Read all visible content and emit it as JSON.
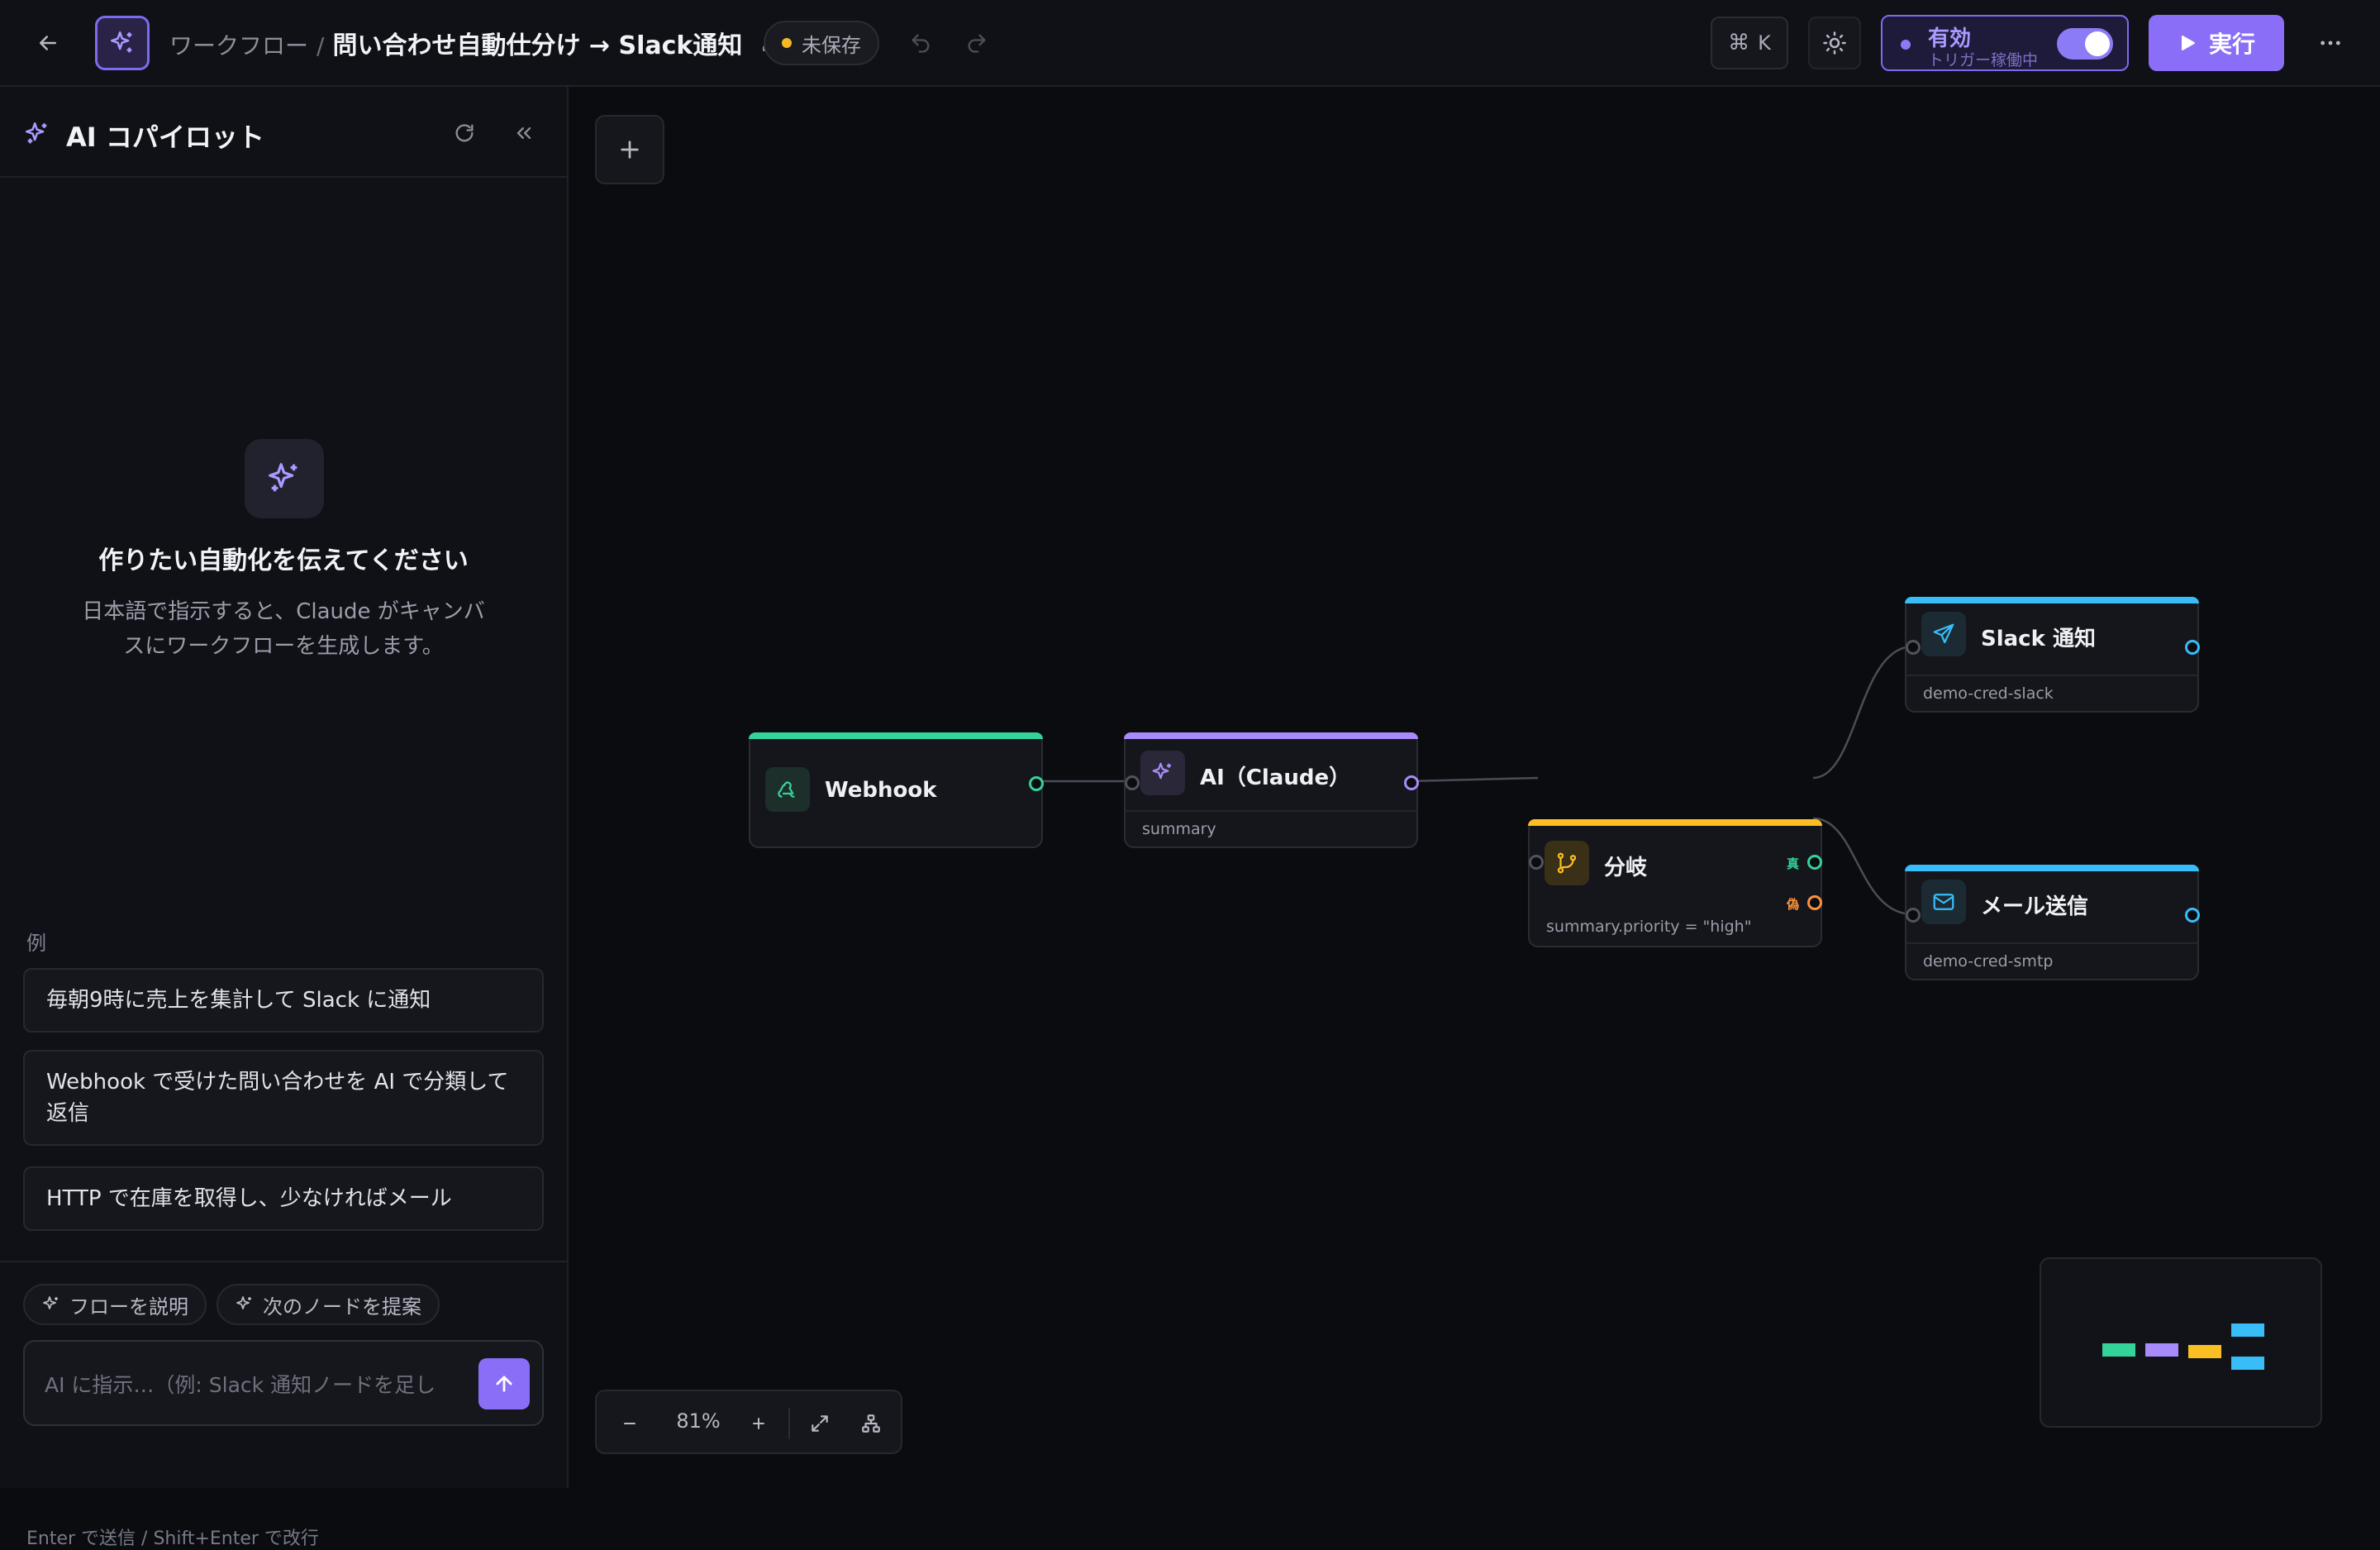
{
  "header": {
    "breadcrumb_parent": "ワークフロー",
    "breadcrumb_sep": "/",
    "title": "問い合わせ自動仕分け → Slack通知",
    "unsaved": "未保存",
    "kbd_shortcut": "K",
    "active_label": "有効",
    "active_sub": "トリガー稼働中",
    "active_on": true,
    "run_label": "実行"
  },
  "sidebar": {
    "title": "AI コパイロット",
    "empty_title": "作りたい自動化を伝えてください",
    "empty_desc": "日本語で指示すると、Claude がキャンバスにワークフローを生成します。",
    "examples_label": "例",
    "examples": [
      "毎朝9時に売上を集計して Slack に通知",
      "Webhook で受けた問い合わせを AI で分類して返信",
      "HTTP で在庫を取得し、少なければメール"
    ],
    "chips": [
      "フローを説明",
      "次のノードを提案"
    ],
    "input_placeholder": "AI に指示…（例: Slack 通知ノードを足し",
    "hint": "Enter で送信 / Shift+Enter で改行"
  },
  "canvas": {
    "zoom": "81%",
    "nodes": [
      {
        "id": "webhook",
        "label": "Webhook",
        "sub": "",
        "color": "#34d399"
      },
      {
        "id": "ai",
        "label": "AI（Claude）",
        "sub": "summary",
        "color": "#a78bfa"
      },
      {
        "id": "branch",
        "label": "分岐",
        "sub": "summary.priority = \"high\"",
        "color": "#fbbf24",
        "true_label": "真",
        "false_label": "偽"
      },
      {
        "id": "slack",
        "label": "Slack 通知",
        "sub": "demo-cred-slack",
        "color": "#38bdf8"
      },
      {
        "id": "mail",
        "label": "メール送信",
        "sub": "demo-cred-smtp",
        "color": "#38bdf8"
      }
    ]
  },
  "colors": {
    "accent": "#8b6ef7",
    "webhook": "#34d399",
    "ai": "#a78bfa",
    "branch": "#fbbf24",
    "action": "#38bdf8",
    "false_port": "#fb923c"
  }
}
